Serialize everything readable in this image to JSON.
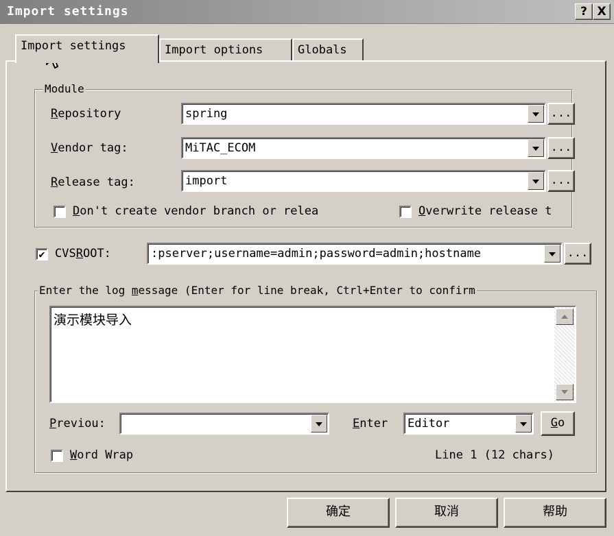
{
  "window": {
    "title": "Import settings",
    "help_glyph": "?",
    "close_glyph": "X"
  },
  "tabs": [
    {
      "label": "Import settings",
      "active": true
    },
    {
      "label": "Import options",
      "active": false
    },
    {
      "label": "Globals",
      "active": false
    }
  ],
  "module": {
    "legend": "Module",
    "repository": {
      "label": "Repository",
      "accel": "R",
      "rest": "epository",
      "value": "spring"
    },
    "vendor_tag": {
      "label": "Vendor tag:",
      "accel": "V",
      "rest": "endor tag:",
      "value": "MiTAC_ECOM"
    },
    "release_tag": {
      "label": "Release tag:",
      "accel": "R",
      "rest": "elease tag:",
      "value": "import"
    },
    "browse_label": "...",
    "dont_create": {
      "accel": "D",
      "rest": "on't create vendor branch or relea",
      "checked": false
    },
    "overwrite": {
      "accel": "O",
      "rest": "verwrite release t",
      "checked": false
    }
  },
  "cvsroot": {
    "checked": true,
    "check_glyph": "✔",
    "label_pre": "CVS",
    "accel": "R",
    "label_post": "OOT:",
    "value": ":pserver;username=admin;password=admin;hostname"
  },
  "log": {
    "legend_pre": "Enter the log ",
    "legend_accel": "m",
    "legend_post": "essage (Enter for line break, Ctrl+Enter to confirm",
    "message": "演示模块导入",
    "previous_accel": "P",
    "previous_rest": "reviou:",
    "enter_accel": "E",
    "enter_rest": "nter",
    "editor_value": "Editor",
    "go_accel": "G",
    "go_rest": "o",
    "word_wrap_accel": "W",
    "word_wrap_rest": "ord Wrap",
    "status": "Line 1 (12 chars)"
  },
  "buttons": {
    "ok": "确定",
    "cancel": "取消",
    "help": "帮助"
  }
}
